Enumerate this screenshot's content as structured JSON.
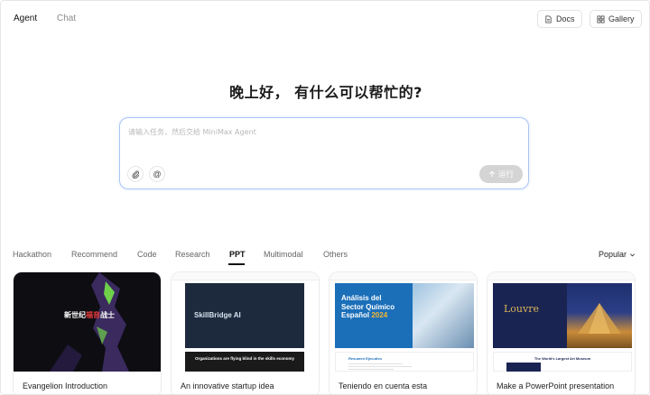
{
  "header": {
    "tabs": [
      {
        "label": "Agent",
        "active": true
      },
      {
        "label": "Chat",
        "active": false
      }
    ],
    "docs_label": "Docs",
    "gallery_label": "Gallery"
  },
  "greeting": "晚上好， 有什么可以帮忙的?",
  "composer": {
    "placeholder": "请输入任务，然后交给 MiniMax Agent",
    "value": "",
    "attach_icon": "paperclip-icon",
    "mention_icon": "at-icon",
    "run_label": "运行"
  },
  "categories": {
    "items": [
      "Hackathon",
      "Recommend",
      "Code",
      "Research",
      "PPT",
      "Multimodal",
      "Others"
    ],
    "active": "PPT"
  },
  "sort": {
    "selected": "Popular"
  },
  "cards": [
    {
      "title": "Evangelion Introduction",
      "thumb_caption_white": "新世纪",
      "thumb_caption_red": "福音",
      "thumb_caption_white2": "战士"
    },
    {
      "title": "An innovative startup idea",
      "thumb_heading": "SkillBridge AI",
      "thumb_banner": "Organizations are flying blind in the skills economy"
    },
    {
      "title": "Teniendo en cuenta esta",
      "thumb_heading_1": "Análisis del",
      "thumb_heading_2": "Sector Químico",
      "thumb_heading_3": "Español",
      "thumb_year": "2024",
      "thumb_section": "Resumen Ejecutivo"
    },
    {
      "title": "Make a PowerPoint presentation",
      "thumb_heading": "Louvre",
      "thumb_banner": "The World's Largest Art Museum"
    }
  ],
  "colors": {
    "accent_border": "#a9c4f5",
    "run_button_disabled": "#d4d4d4",
    "active_tab": "#111111"
  }
}
